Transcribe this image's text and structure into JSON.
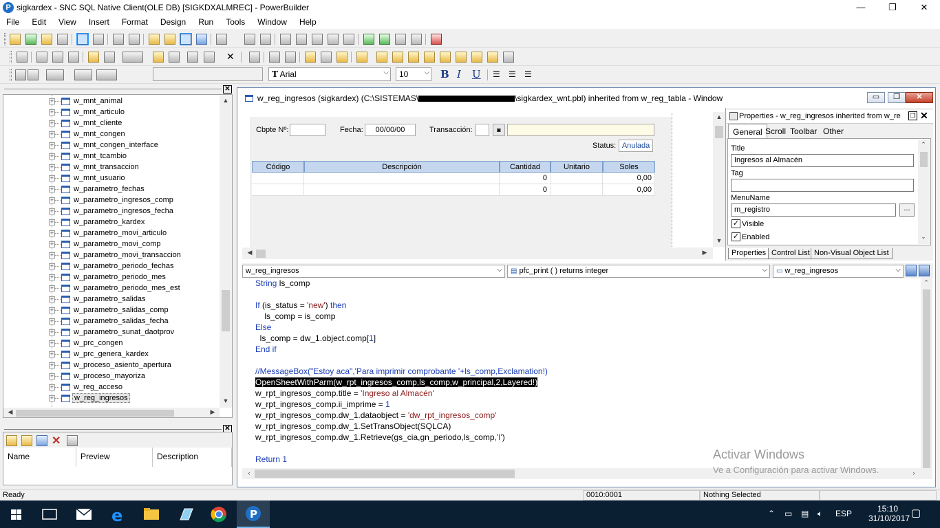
{
  "window": {
    "title": "sigkardex - SNC SQL Native Client(OLE DB) [SIGKDXALMREC] - PowerBuilder",
    "minimize": "—",
    "restore": "❐",
    "close": "✕"
  },
  "menu": [
    "File",
    "Edit",
    "View",
    "Insert",
    "Format",
    "Design",
    "Run",
    "Tools",
    "Window",
    "Help"
  ],
  "font_toolbar": {
    "font_name": "Arial",
    "font_size": "10",
    "bold": "B",
    "italic": "I",
    "underline": "U"
  },
  "tree": {
    "items": [
      "w_mnt_animal",
      "w_mnt_articulo",
      "w_mnt_cliente",
      "w_mnt_congen",
      "w_mnt_congen_interface",
      "w_mnt_tcambio",
      "w_mnt_transaccion",
      "w_mnt_usuario",
      "w_parametro_fechas",
      "w_parametro_ingresos_comp",
      "w_parametro_ingresos_fecha",
      "w_parametro_kardex",
      "w_parametro_movi_articulo",
      "w_parametro_movi_comp",
      "w_parametro_movi_transaccion",
      "w_parametro_periodo_fechas",
      "w_parametro_periodo_mes",
      "w_parametro_periodo_mes_est",
      "w_parametro_salidas",
      "w_parametro_salidas_comp",
      "w_parametro_salidas_fecha",
      "w_parametro_sunat_daotprov",
      "w_prc_congen",
      "w_prc_genera_kardex",
      "w_proceso_asiento_apertura",
      "w_proceso_mayoriza",
      "w_reg_acceso",
      "w_reg_ingresos"
    ],
    "selected": "w_reg_ingresos"
  },
  "lower_panel": {
    "columns": [
      "Name",
      "Preview",
      "Description"
    ]
  },
  "mdi": {
    "title_prefix": "w_reg_ingresos (sigkardex) (C:\\SISTEMAS\\",
    "title_suffix": "\\sigkardex_wnt.pbl) inherited from w_reg_tabla - Window"
  },
  "form": {
    "cbpte_label": "Cbpte Nº:",
    "fecha_label": "Fecha:",
    "fecha_value": "00/00/00",
    "transaccion_label": "Transacción:",
    "status_label": "Status:",
    "status_value": "Anulada",
    "grid_headers": [
      "Código",
      "Descripción",
      "Cantidad",
      "Unitario",
      "Soles"
    ],
    "grid_rows": [
      {
        "cantidad": "0",
        "soles": "0,00"
      },
      {
        "cantidad": "0",
        "soles": "0,00"
      }
    ]
  },
  "properties": {
    "title": "Properties - w_reg_ingresos  inherited  from  w_re",
    "tabs": [
      "General",
      "Scroll",
      "Toolbar",
      "Other"
    ],
    "title_label": "Title",
    "title_value": "Ingresos al Almacén",
    "tag_label": "Tag",
    "tag_value": "",
    "menuname_label": "MenuName",
    "menuname_value": "m_registro",
    "browse": "...",
    "visible_label": "Visible",
    "enabled_label": "Enabled",
    "bottom_tabs": [
      "Properties",
      "Control List",
      "Non-Visual Object List"
    ]
  },
  "script": {
    "object": "w_reg_ingresos",
    "event": "pfc_print ( )  returns integer",
    "ancestor": "w_reg_ingresos"
  },
  "activate": {
    "line1": "Activar Windows",
    "line2": "Ve a Configuración para activar Windows."
  },
  "statusbar": {
    "ready": "Ready",
    "position": "0010:0001",
    "selection": "Nothing Selected"
  },
  "taskbar": {
    "lang": "ESP",
    "time": "15:10",
    "date": "31/10/2017"
  }
}
